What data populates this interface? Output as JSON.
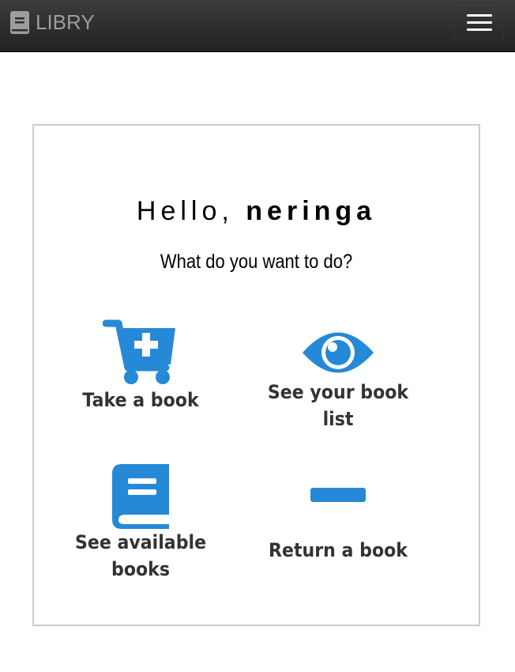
{
  "navbar": {
    "brand_text": "LIBRY",
    "brand_icon": "book-icon",
    "menu_icon": "hamburger-menu-icon"
  },
  "greeting": {
    "prefix": "Hello, ",
    "username": "neringa"
  },
  "question": "What do you want to do?",
  "actions": [
    {
      "label": "Take a book",
      "icon": "cart-plus-icon"
    },
    {
      "label": "See your book list",
      "icon": "eye-icon"
    },
    {
      "label": "See available books",
      "icon": "book-icon"
    },
    {
      "label": "Return a book",
      "icon": "minus-icon"
    }
  ],
  "colors": {
    "accent": "#2589d8",
    "navbar": "#2d2d2d",
    "brand": "#9d9d9d"
  }
}
